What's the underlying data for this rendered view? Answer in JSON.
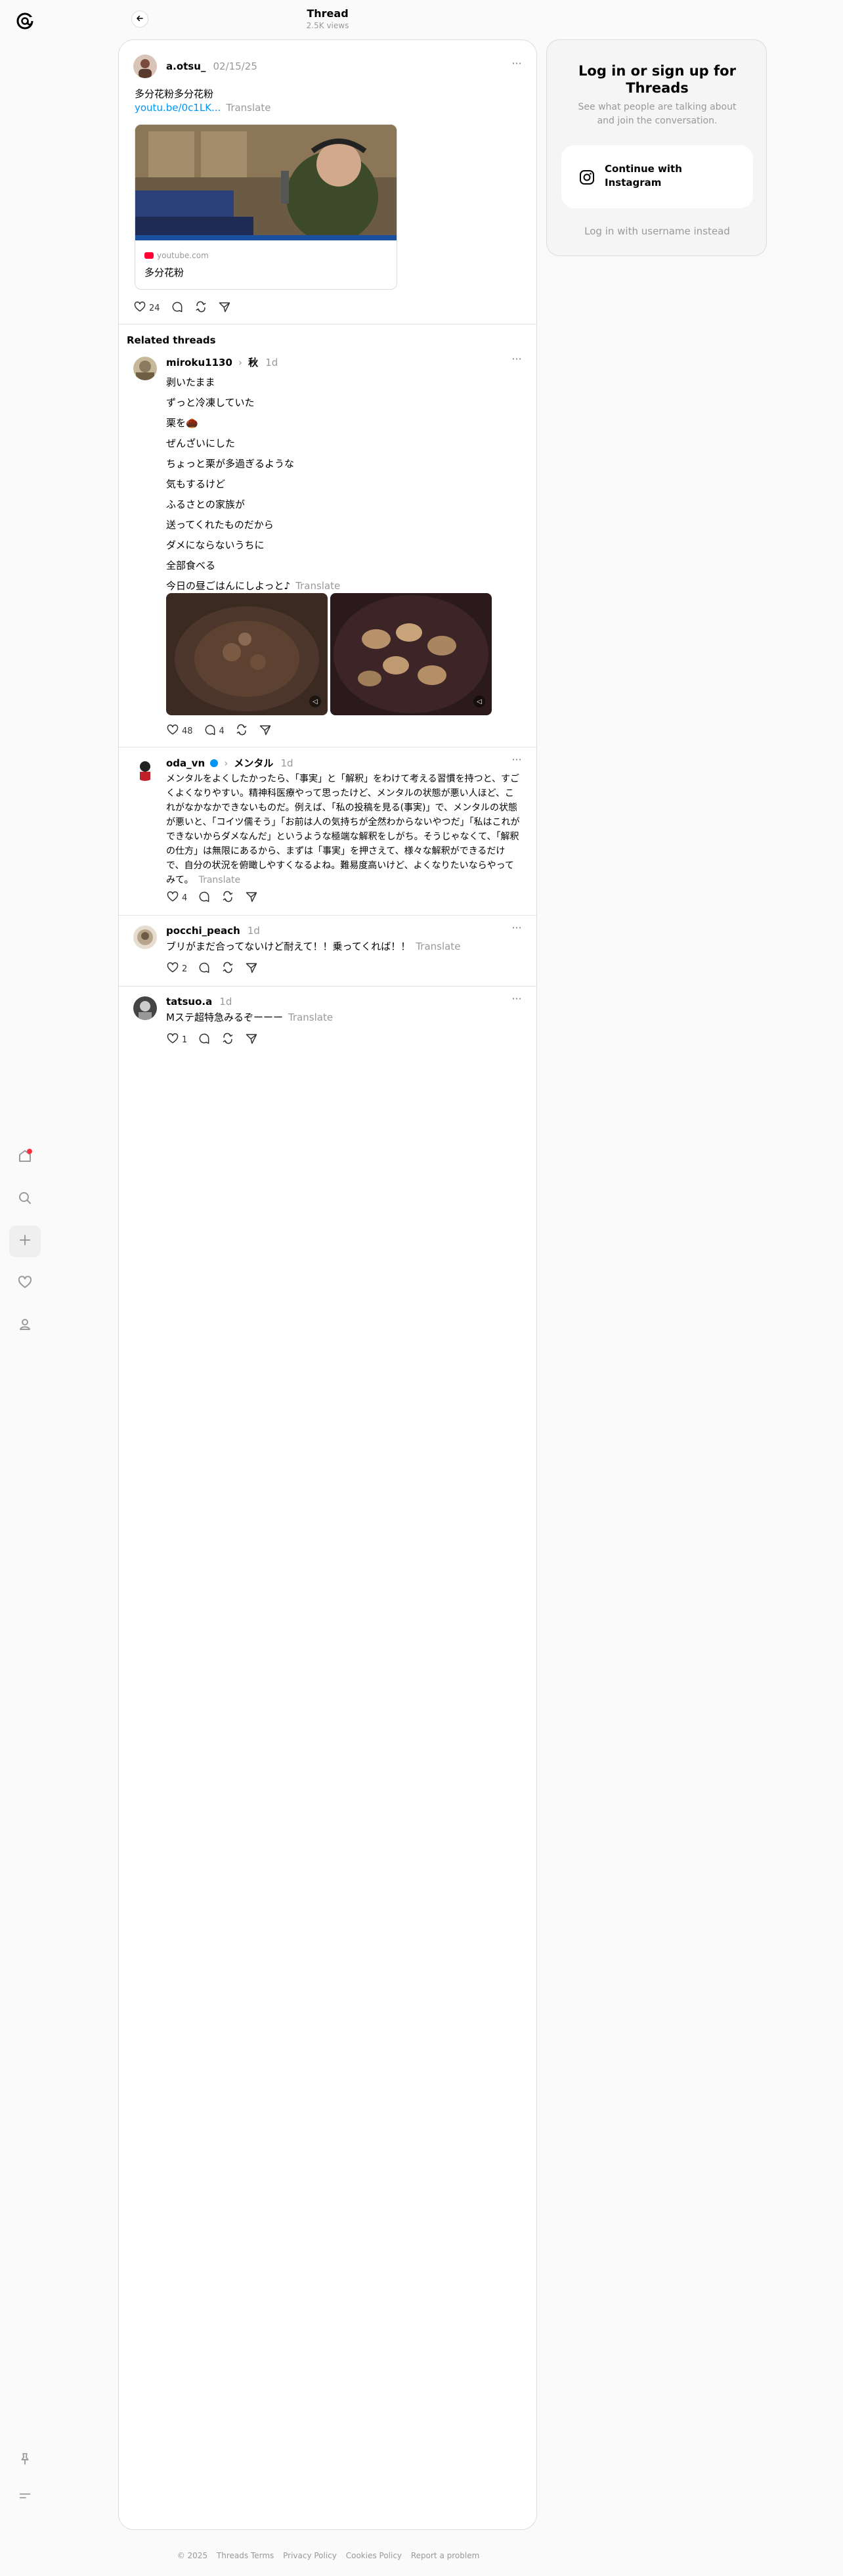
{
  "header": {
    "title": "Thread",
    "views": "2.5K views"
  },
  "main_post": {
    "username": "a.otsu_",
    "date": "02/15/25",
    "text": "多分花粉多分花粉",
    "link": "youtu.be/0c1LK...",
    "translate": "Translate",
    "link_card": {
      "domain": "youtube.com",
      "title": "多分花粉"
    },
    "likes": "24"
  },
  "related_title": "Related threads",
  "related": [
    {
      "username": "miroku1130",
      "topic": "秋",
      "time": "1d",
      "lines": [
        "剥いたまま",
        "ずっと冷凍していた",
        "栗を🌰",
        "ぜんざいにした",
        "ちょっと栗が多過ぎるような",
        "気もするけど",
        "ふるさとの家族が",
        "送ってくれたものだから",
        "ダメにならないうちに",
        "全部食べる",
        "今日の昼ごはんにしよっと♪"
      ],
      "translate": "Translate",
      "likes": "48",
      "replies": "4"
    },
    {
      "username": "oda_vn",
      "topic": "メンタル",
      "time": "1d",
      "text": "メンタルをよくしたかったら、「事実」と「解釈」をわけて考える習慣を持つと、すごくよくなりやすい。精神科医療やって思ったけど、メンタルの状態が悪い人ほど、これがなかなかできないものだ。例えば、「私の投稿を見る(事実)」で、メンタルの状態が悪いと、「コイツ儒そう」「お前は人の気持ちが全然わからないやつだ」「私はこれができないからダメなんだ」というような極端な解釈をしがち。そうじゃなくて、「解釈の仕方」は無限にあるから、まずは「事実」を押さえて、様々な解釈ができるだけで、自分の状況を俯瞰しやすくなるよね。難易度高いけど、よくなりたいならやってみて。",
      "translate": "Translate",
      "likes": "4"
    },
    {
      "username": "pocchi_peach",
      "time": "1d",
      "text": "ブリがまだ合ってないけど耐えて！！乗ってくれば！！",
      "translate": "Translate",
      "likes": "2"
    },
    {
      "username": "tatsuo.a",
      "time": "1d",
      "text": "Mステ超特急みるぞーーー",
      "translate": "Translate",
      "likes": "1"
    }
  ],
  "login_card": {
    "title": "Log in or sign up for Threads",
    "subtitle": "See what people are talking about and join the conversation.",
    "instagram_button": "Continue with Instagram",
    "alt_login": "Log in with username instead"
  },
  "footer": [
    "© 2025",
    "Threads Terms",
    "Privacy Policy",
    "Cookies Policy",
    "Report a problem"
  ]
}
